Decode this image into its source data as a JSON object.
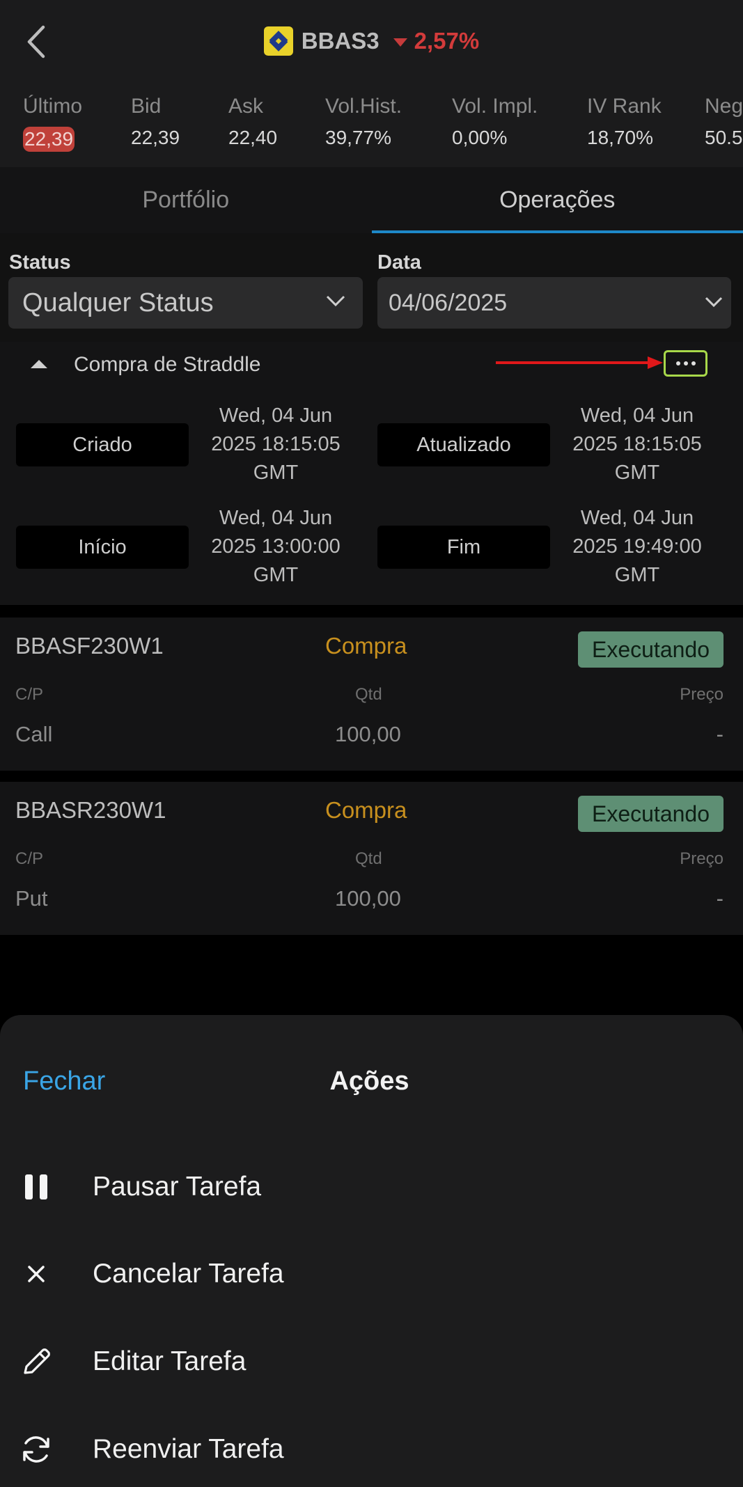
{
  "header": {
    "ticker": "BBAS3",
    "change": "2,57%",
    "accent_down": "#d33b3b"
  },
  "quotes": [
    {
      "label": "Último",
      "value": "22,39",
      "highlight": true
    },
    {
      "label": "Bid",
      "value": "22,39"
    },
    {
      "label": "Ask",
      "value": "22,40"
    },
    {
      "label": "Vol.Hist.",
      "value": "39,77%"
    },
    {
      "label": "Vol. Impl.",
      "value": "0,00%"
    },
    {
      "label": "IV Rank",
      "value": "18,70%"
    },
    {
      "label": "Neg",
      "value": "50.5"
    }
  ],
  "tabs": [
    {
      "label": "Portfólio",
      "active": false
    },
    {
      "label": "Operações",
      "active": true
    }
  ],
  "filters": {
    "status_label": "Status",
    "status_value": "Qualquer Status",
    "date_label": "Data",
    "date_value": "04/06/2025"
  },
  "strategy": {
    "name": "Compra de Straddle",
    "created_label": "Criado",
    "created_value": "Wed, 04 Jun 2025 18:15:05 GMT",
    "updated_label": "Atualizado",
    "updated_value": "Wed, 04 Jun 2025 18:15:05 GMT",
    "start_label": "Início",
    "start_value": "Wed, 04 Jun 2025 13:00:00 GMT",
    "end_label": "Fim",
    "end_value": "Wed, 04 Jun 2025 19:49:00 GMT"
  },
  "legs": [
    {
      "symbol": "BBASF230W1",
      "side": "Compra",
      "status": "Executando",
      "cp_header": "C/P",
      "qty_header": "Qtd",
      "price_header": "Preço",
      "cp": "Call",
      "qty": "100,00",
      "price": "-"
    },
    {
      "symbol": "BBASR230W1",
      "side": "Compra",
      "status": "Executando",
      "cp_header": "C/P",
      "qty_header": "Qtd",
      "price_header": "Preço",
      "cp": "Put",
      "qty": "100,00",
      "price": "-"
    }
  ],
  "sheet": {
    "close_label": "Fechar",
    "title": "Ações",
    "actions": [
      {
        "label": "Pausar Tarefa",
        "icon": "pause-icon"
      },
      {
        "label": "Cancelar Tarefa",
        "icon": "close-icon"
      },
      {
        "label": "Editar Tarefa",
        "icon": "pencil-icon"
      },
      {
        "label": "Reenviar Tarefa",
        "icon": "refresh-icon"
      }
    ]
  }
}
